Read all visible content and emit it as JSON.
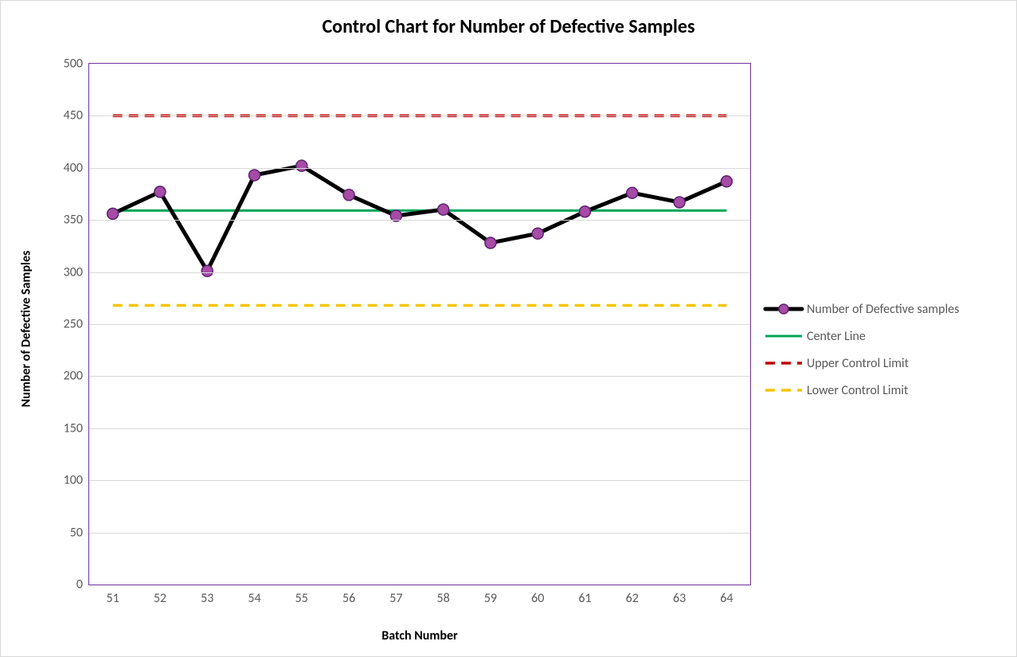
{
  "chart_data": {
    "type": "line",
    "title": "Control Chart for Number of Defective Samples",
    "xlabel": "Batch Number",
    "ylabel": "Number of Defective Samples",
    "ylim": [
      0,
      500
    ],
    "ytick_step": 50,
    "categories": [
      51,
      52,
      53,
      54,
      55,
      56,
      57,
      58,
      59,
      60,
      61,
      62,
      63,
      64
    ],
    "series": [
      {
        "name": "Number of Defective samples",
        "values": [
          356,
          377,
          301,
          393,
          402,
          374,
          354,
          360,
          328,
          337,
          358,
          376,
          367,
          387
        ]
      },
      {
        "name": "Center Line",
        "value": 359
      },
      {
        "name": "Upper Control Limit",
        "value": 450
      },
      {
        "name": "Lower Control Limit",
        "value": 268
      }
    ]
  },
  "legend": {
    "items": [
      "Number of Defective samples",
      "Center Line",
      "Upper Control Limit",
      "Lower Control Limit"
    ]
  },
  "colors": {
    "plot_border": "#7030a0",
    "grid": "#d9d9d9",
    "data_line": "#000000",
    "data_marker_fill": "#a64ca6",
    "data_marker_stroke": "#5b2270",
    "center_line": "#00a65a",
    "ucl": "#c00000",
    "lcl": "#f5c500"
  }
}
